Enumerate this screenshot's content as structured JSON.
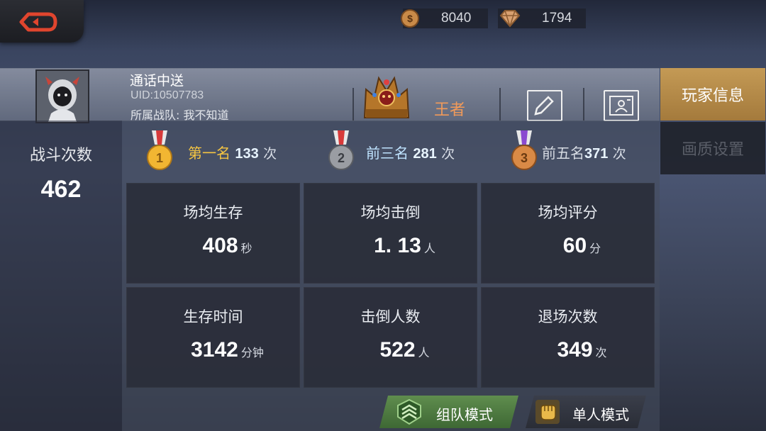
{
  "currency": {
    "gold": {
      "icon": "coin-icon",
      "value": "8040"
    },
    "gems": {
      "icon": "diamond-icon",
      "value": "1794"
    }
  },
  "player": {
    "name": "通话中送",
    "uid": "UID:10507783",
    "team": "所属战队:   我不知道",
    "rank_title": "王者"
  },
  "tabs": [
    {
      "label": "玩家信息",
      "active": true
    },
    {
      "label": "画质设置",
      "active": false
    }
  ],
  "battles": {
    "label": "战斗次数",
    "value": "462"
  },
  "medals": [
    {
      "label": "第一名",
      "count": "133",
      "unit": "次",
      "icon": "gold-medal-1-icon"
    },
    {
      "label": "前三名",
      "count": "281",
      "unit": "次",
      "icon": "silver-medal-2-icon"
    },
    {
      "label": "前五名",
      "count": "371",
      "unit": "次",
      "icon": "bronze-medal-3-icon"
    }
  ],
  "stats": [
    {
      "title": "场均生存",
      "value": "408",
      "unit": "秒"
    },
    {
      "title": "场均击倒",
      "value": "1. 13",
      "unit": "人"
    },
    {
      "title": "场均评分",
      "value": "60",
      "unit": "分"
    },
    {
      "title": "生存时间",
      "value": "3142",
      "unit": "分钟"
    },
    {
      "title": "击倒人数",
      "value": "522",
      "unit": "人"
    },
    {
      "title": "退场次数",
      "value": "349",
      "unit": "次"
    }
  ],
  "modes": {
    "team": "组队模式",
    "solo": "单人模式"
  },
  "colors": {
    "active_tab": "#b88c4a",
    "rank_title": "#f19a5a",
    "medal_first": "#f5c542",
    "team_button": "#4f7c42"
  }
}
